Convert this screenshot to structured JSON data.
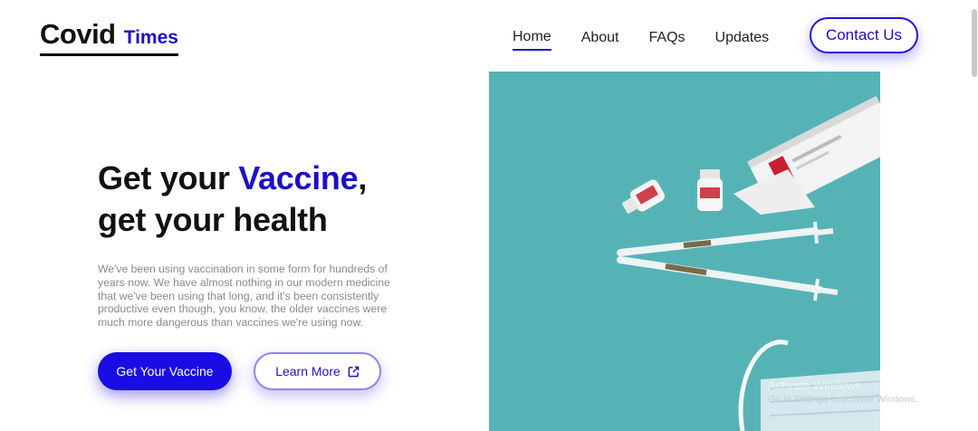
{
  "logo": {
    "main": "Covid",
    "accent": "Times"
  },
  "nav": {
    "items": [
      {
        "label": "Home",
        "active": true
      },
      {
        "label": "About",
        "active": false
      },
      {
        "label": "FAQs",
        "active": false
      },
      {
        "label": "Updates",
        "active": false
      }
    ],
    "contact_label": "Contact Us"
  },
  "hero": {
    "title_part1": "Get your ",
    "title_accent": "Vaccine",
    "title_part2": ",",
    "title_line2": "get your health",
    "description": "We've been using vaccination in some form for hundreds of years now. We have almost nothing in our modern medicine that we've been using that long, and it's been consistently productive even though, you know, the older vaccines were much more dangerous than vaccines we're using now.",
    "primary_button": "Get Your Vaccine",
    "secondary_button": "Learn More",
    "secondary_icon": "external-link-icon"
  },
  "watermark": {
    "line1": "Activate Windows",
    "line2": "Go to Settings to activate Windows."
  },
  "colors": {
    "accent": "#1c10c8",
    "button_primary": "#1a0de4",
    "image_bg": "#55b3b6"
  }
}
